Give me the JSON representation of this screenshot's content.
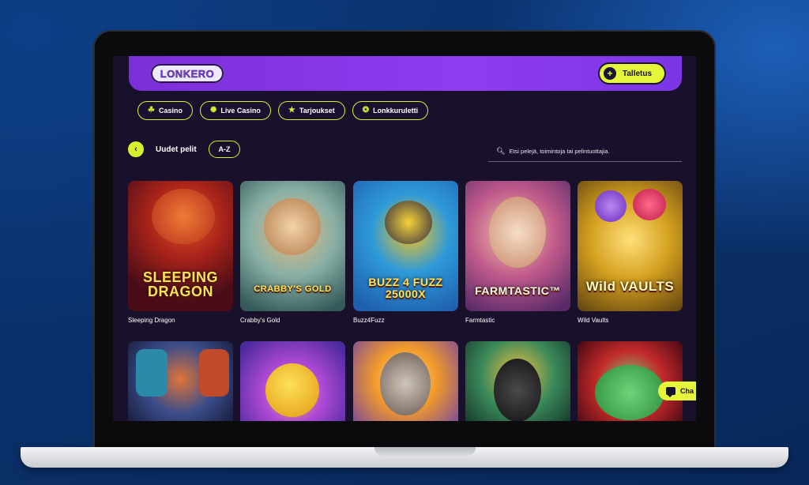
{
  "header": {
    "logo_text": "LONKERO",
    "deposit_label": "Talletus",
    "deposit_icon": "plus-icon"
  },
  "nav": [
    {
      "label": "Casino",
      "icon": "casino-icon"
    },
    {
      "label": "Live Casino",
      "icon": "live-casino-icon"
    },
    {
      "label": "Tarjoukset",
      "icon": "star-icon"
    },
    {
      "label": "Lonkkuruletti",
      "icon": "wheel-icon"
    }
  ],
  "section": {
    "title": "Uudet pelit",
    "sort_label": "A-Z"
  },
  "search": {
    "placeholder": "Etsi pelejä, toimintoja tai pelintuottajia."
  },
  "games_row1": [
    {
      "name": "Sleeping Dragon",
      "art_title": "SLEEPING DRAGON"
    },
    {
      "name": "Crabby's Gold",
      "art_title": "CRABBY'S GOLD"
    },
    {
      "name": "Buzz4Fuzz",
      "art_title": "BUZZ 4 FUZZ 25000X"
    },
    {
      "name": "Farmtastic",
      "art_title": "FARMTASTIC™"
    },
    {
      "name": "Wild Vaults",
      "art_title": "Wild VAULTS"
    }
  ],
  "chat": {
    "label": "Cha"
  },
  "colors": {
    "accent": "#e5f53a",
    "header_purple": "#8f3cf0",
    "screen_bg": "#19112b"
  }
}
